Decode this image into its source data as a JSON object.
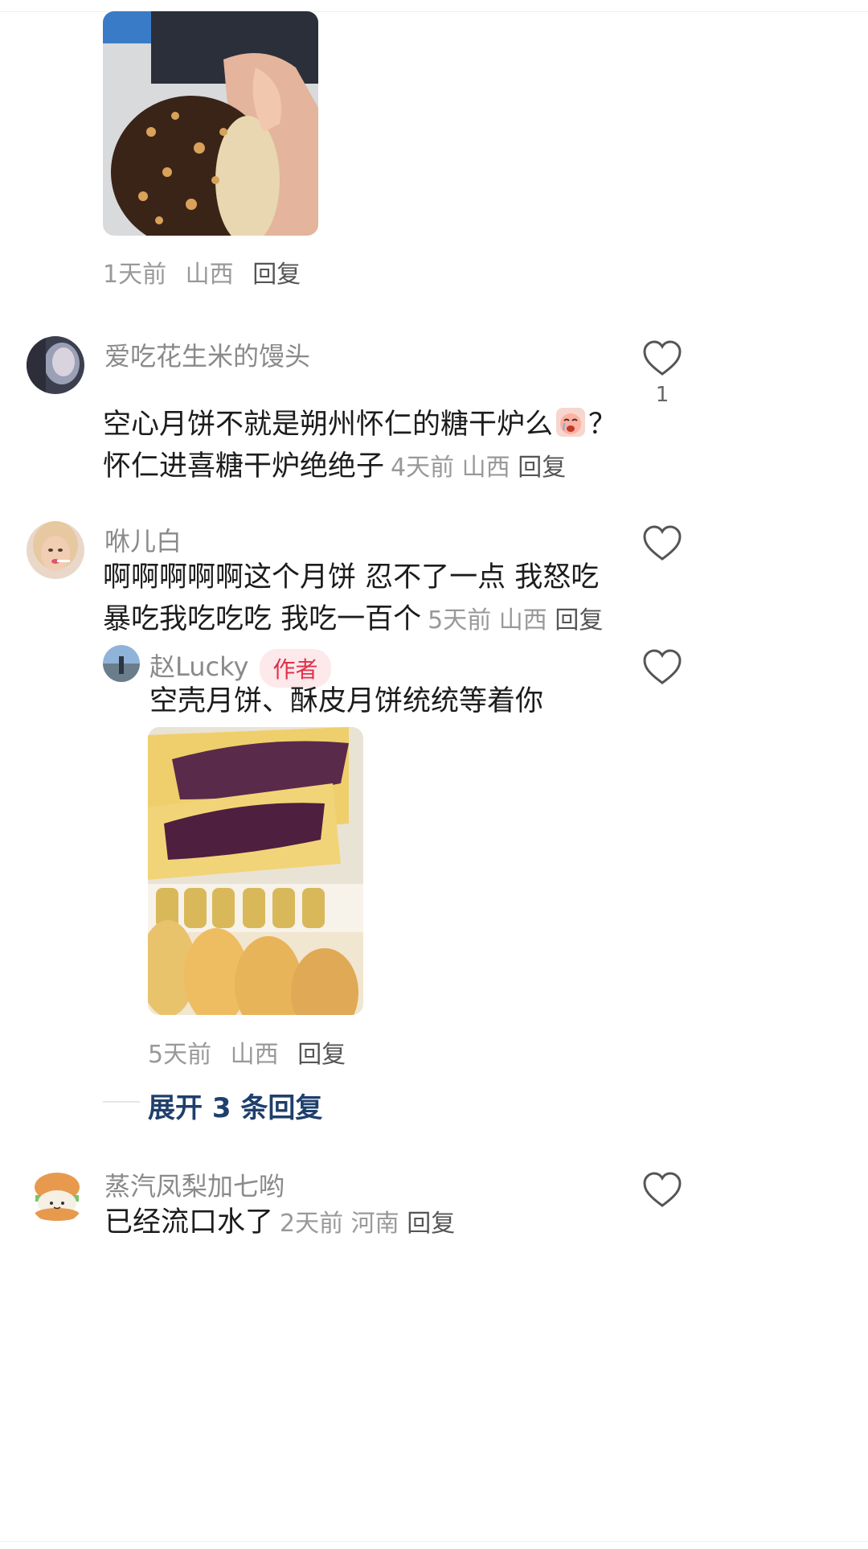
{
  "top_comment": {
    "meta": {
      "time": "1天前",
      "location": "山西",
      "reply_label": "回复"
    }
  },
  "comments": [
    {
      "username": "爱吃花生米的馒头",
      "text_part1": "空心月饼不就是朔州怀仁的糖干炉么",
      "emoji_icon": "crying-face-emoji-icon",
      "text_part2": "？怀仁进喜糖干炉绝绝子",
      "time": "4天前",
      "location": "山西",
      "reply_label": "回复",
      "likes": "1"
    },
    {
      "username": "咻儿白",
      "text": "啊啊啊啊啊这个月饼 忍不了一点 我怒吃暴吃我吃吃吃 我吃一百个",
      "time": "5天前",
      "location": "山西",
      "reply_label": "回复",
      "reply": {
        "username": "赵Lucky",
        "badge": "作者",
        "text": "空壳月饼、酥皮月饼统统等着你",
        "time": "5天前",
        "location": "山西",
        "reply_label": "回复"
      },
      "expand_label": "展开 3 条回复"
    },
    {
      "username": "蒸汽凤梨加七哟",
      "text": "已经流口水了",
      "time": "2天前",
      "location": "河南",
      "reply_label": "回复"
    }
  ],
  "colors": {
    "accent_link": "#1f3f6c",
    "badge_bg": "#fde8ea",
    "badge_text": "#e0304a"
  }
}
